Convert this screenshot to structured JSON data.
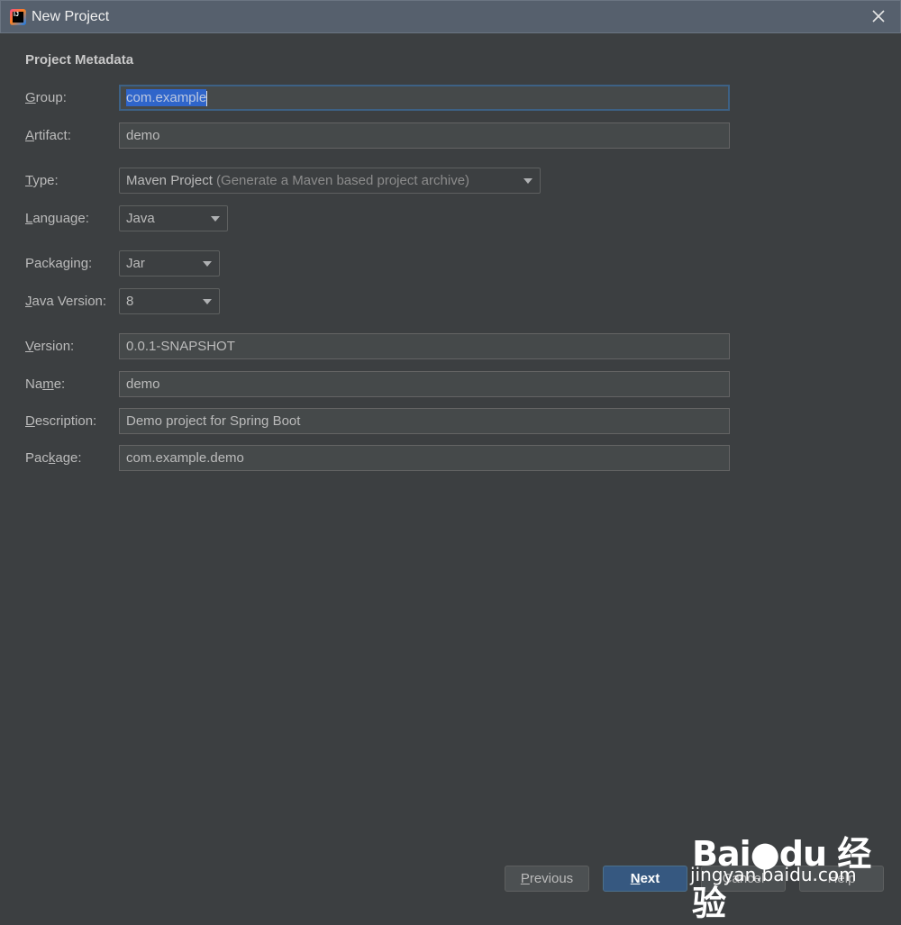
{
  "window": {
    "title": "New Project"
  },
  "section_title": "Project Metadata",
  "rows": {
    "group": {
      "label_u": "G",
      "label_rest": "roup:",
      "value_selected": "com.example"
    },
    "artifact": {
      "label_u": "A",
      "label_rest": "rtifact:",
      "value": "demo"
    },
    "type": {
      "label_u": "T",
      "label_rest": "ype:",
      "value": "Maven Project",
      "hint": "(Generate a Maven based project archive)"
    },
    "language": {
      "label_u": "L",
      "label_rest": "anguage:",
      "value": "Java"
    },
    "packaging": {
      "label": "Packaging:",
      "value": "Jar"
    },
    "java_version": {
      "label_u": "J",
      "label_rest": "ava Version:",
      "value": "8"
    },
    "version": {
      "label_u": "V",
      "label_rest": "ersion:",
      "value": "0.0.1-SNAPSHOT"
    },
    "name": {
      "label_pre": "Na",
      "label_u": "m",
      "label_rest": "e:",
      "value": "demo"
    },
    "description": {
      "label_u": "D",
      "label_rest": "escription:",
      "value": "Demo project for Spring Boot"
    },
    "package": {
      "label_pre": "Pac",
      "label_u": "k",
      "label_rest": "age:",
      "value": "com.example.demo"
    }
  },
  "buttons": {
    "previous": {
      "u": "P",
      "rest": "revious"
    },
    "next": {
      "u": "N",
      "rest": "ext"
    },
    "cancel": {
      "label": "Cancel"
    },
    "help": {
      "label": "Help"
    }
  },
  "watermark": {
    "logo": "Bai●du 经验",
    "domain": "jingyan.baidu.com"
  },
  "colors": {
    "background": "#3c3f41",
    "titlebar": "#56606d",
    "field_bg": "#45494a",
    "selection": "#2f65ca",
    "primary_button": "#365880"
  },
  "icons": {
    "app": "intellij-idea-icon",
    "close": "close-icon",
    "dropdown": "chevron-down-icon"
  }
}
